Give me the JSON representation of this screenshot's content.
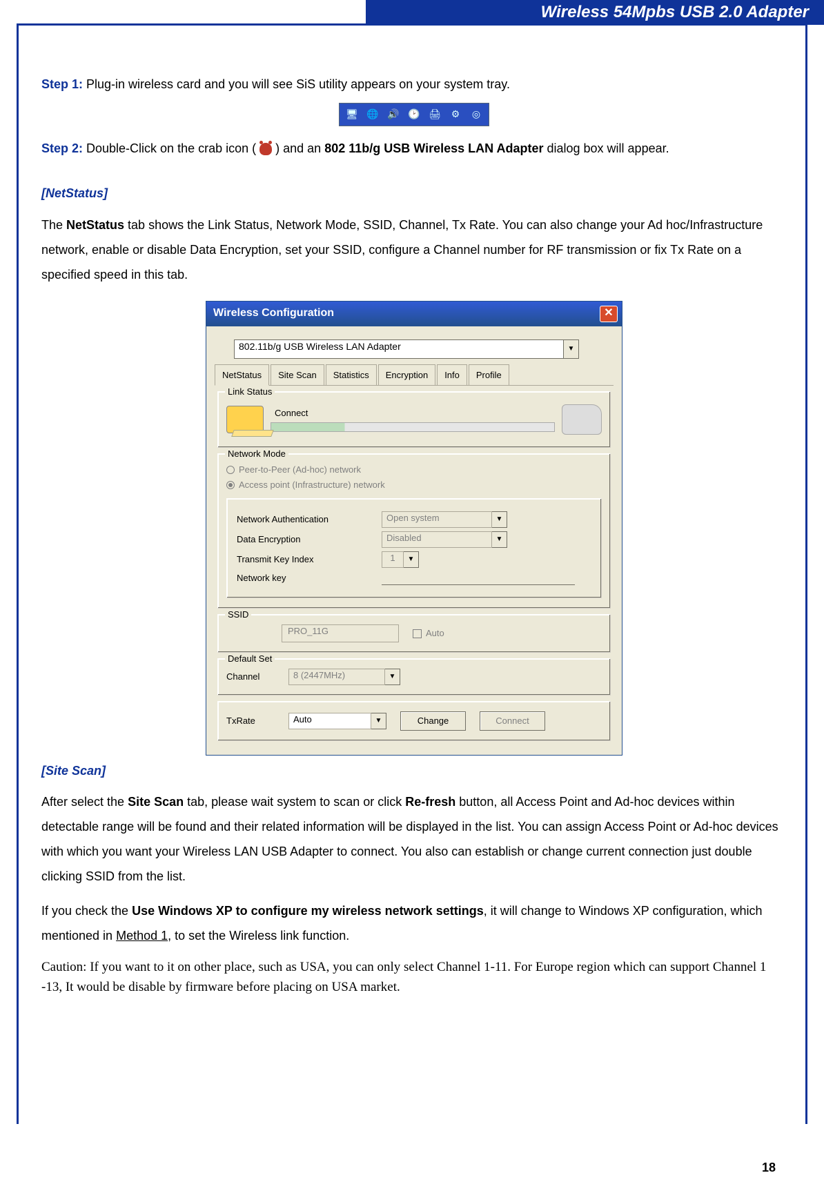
{
  "header": {
    "title": "Wireless 54Mpbs USB 2.0 Adapter"
  },
  "step1": {
    "label": "Step 1:",
    "text": " Plug-in wireless card and you will see SiS utility appears on your system tray."
  },
  "tray_icons": [
    "monitor-icon",
    "globe-icon",
    "sound-icon",
    "clock-icon",
    "printer-icon",
    "gear-icon",
    "target-icon"
  ],
  "step2": {
    "label": "Step 2:",
    "pre": " Double-Click on the crab icon ( ",
    "post_1": " ) and an ",
    "bold": "802 11b/g USB Wireless LAN Adapter",
    "post_2": " dialog box will appear."
  },
  "netstatus": {
    "title": "[NetStatus]",
    "desc_pre": "The ",
    "desc_bold": "NetStatus",
    "desc_post": " tab shows the Link Status, Network Mode, SSID, Channel, Tx Rate. You can also change your Ad hoc/Infrastructure network, enable or disable Data Encryption, set your SSID, configure a Channel number for RF transmission or fix Tx Rate on a specified speed in this tab."
  },
  "dialog": {
    "title": "Wireless Configuration",
    "adapter": "802.11b/g USB Wireless LAN Adapter",
    "tabs": [
      "NetStatus",
      "Site Scan",
      "Statistics",
      "Encryption",
      "Info",
      "Profile"
    ],
    "active_tab": 0,
    "link_status": {
      "legend": "Link Status",
      "text": "Connect"
    },
    "network_mode": {
      "legend": "Network Mode",
      "opt1": "Peer-to-Peer (Ad-hoc) network",
      "opt2": "Access point (Infrastructure) network",
      "selected": 2
    },
    "encryption": {
      "net_auth_label": "Network Authentication",
      "net_auth_value": "Open system",
      "data_enc_label": "Data Encryption",
      "data_enc_value": "Disabled",
      "tki_label": "Transmit Key Index",
      "tki_value": "1",
      "net_key_label": "Network key"
    },
    "ssid": {
      "label": "SSID",
      "value": "PRO_11G",
      "auto_label": "Auto"
    },
    "default_set": {
      "legend": "Default Set",
      "channel_label": "Channel",
      "channel_value": "8  (2447MHz)"
    },
    "txrate": {
      "label": "TxRate",
      "value": "Auto",
      "change_btn": "Change",
      "connect_btn": "Connect"
    }
  },
  "sitescan": {
    "title": "[Site Scan]",
    "p1_pre": "After select the ",
    "p1_b1": "Site Scan",
    "p1_mid": " tab, please wait system to scan or click ",
    "p1_b2": "Re-fresh",
    "p1_post": " button, all Access Point and Ad-hoc devices within detectable range will be found and their related information will be displayed in the list. You can assign Access Point or Ad-hoc devices with which you want your Wireless LAN USB Adapter to connect. You also can establish or change current connection just double clicking SSID from the list.",
    "p2_pre": "If you check the ",
    "p2_b": "Use Windows XP to configure my wireless network settings",
    "p2_mid": ", it will change to Windows XP configuration, which mentioned in ",
    "p2_u": "Method 1",
    "p2_post": ", to set the Wireless link function."
  },
  "caution": "Caution: If you want to it on other place, such as USA, you can only select Channel 1-11. For Europe region which can support Channel 1 -13, It would be disable by firmware before placing on USA market.",
  "page_number": "18"
}
